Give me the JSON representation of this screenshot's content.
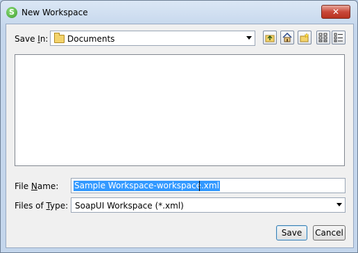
{
  "window": {
    "title": "New Workspace",
    "close_label": "✕"
  },
  "save_in": {
    "label_pre": "Save ",
    "label_mnemonic": "I",
    "label_post": "n:",
    "value": "Documents"
  },
  "toolbar": {
    "buttons": [
      {
        "name": "up-one-level"
      },
      {
        "name": "home"
      },
      {
        "name": "create-new-folder"
      },
      {
        "name": "list-view"
      },
      {
        "name": "details-view"
      }
    ]
  },
  "file_name": {
    "label_pre": "File ",
    "label_mnemonic": "N",
    "label_post": "ame:",
    "value": "Sample Workspace-workspace.xml"
  },
  "file_type": {
    "label_pre": "Files of ",
    "label_mnemonic": "T",
    "label_post": "ype:",
    "value": "SoapUI Workspace (*.xml)"
  },
  "buttons": {
    "save": "Save",
    "cancel": "Cancel"
  }
}
